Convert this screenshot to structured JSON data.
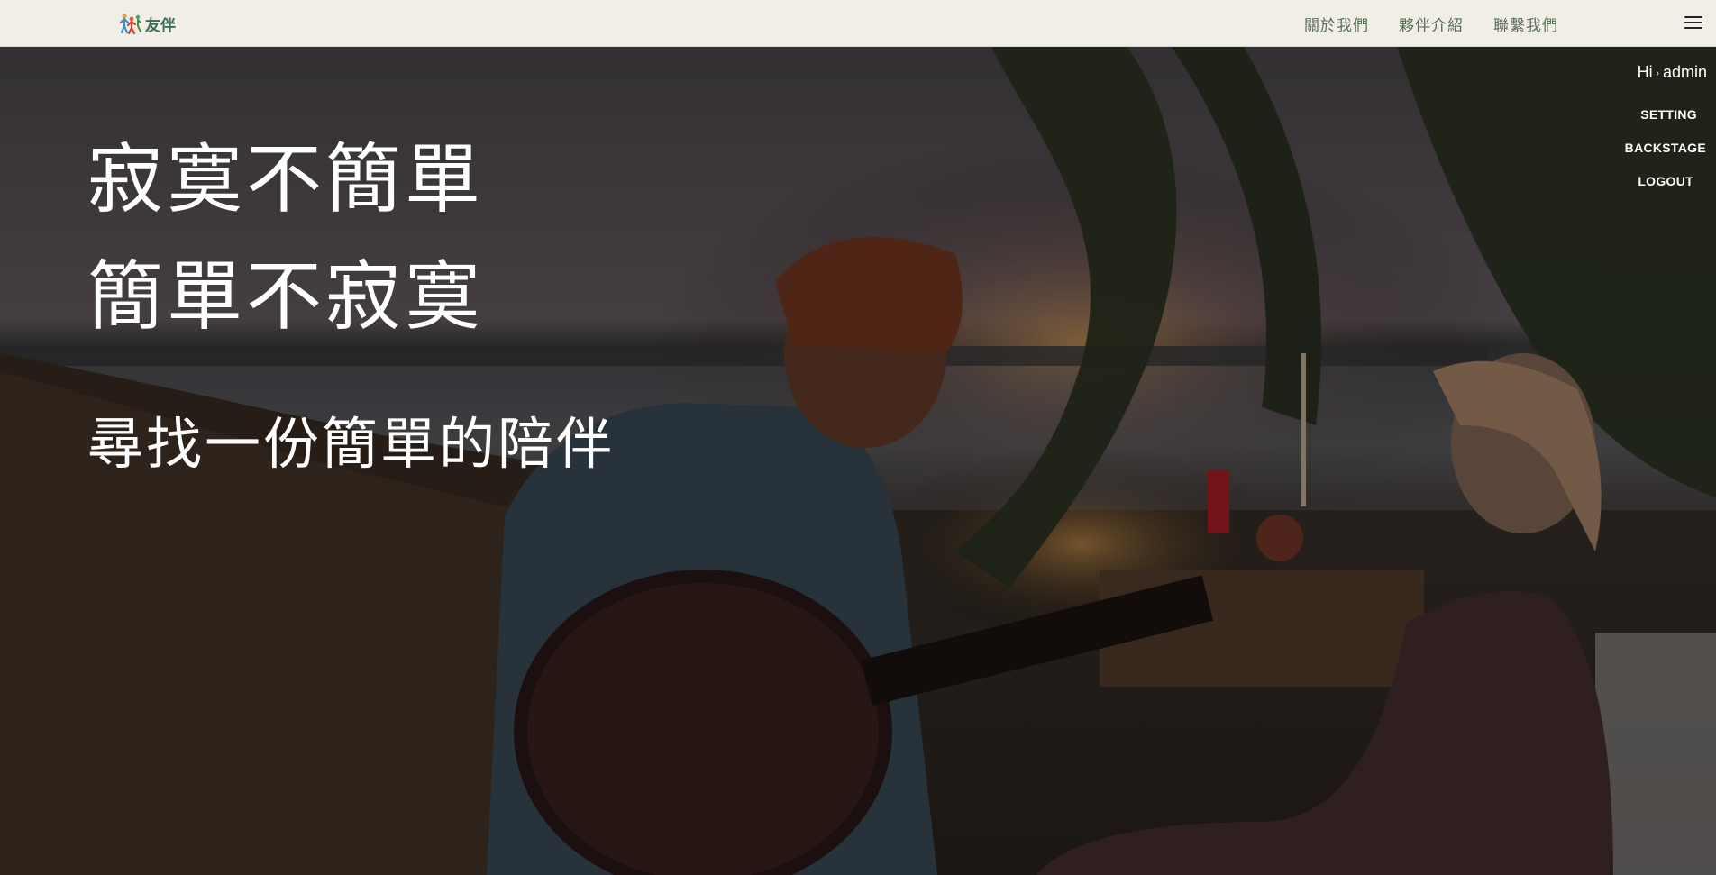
{
  "brand": {
    "name": "友伴"
  },
  "nav": {
    "links": [
      {
        "label": "關於我們"
      },
      {
        "label": "夥伴介紹"
      },
      {
        "label": "聯繫我們"
      }
    ]
  },
  "hero": {
    "line1": "寂寞不簡單",
    "line2": "簡單不寂寞",
    "tagline": "尋找一份簡單的陪伴"
  },
  "user_menu": {
    "greeting_prefix": "Hi",
    "greeting_sep": "›",
    "username": "admin",
    "items": [
      {
        "label": "SETTING"
      },
      {
        "label": "BACKSTAGE"
      },
      {
        "label": "LOGOUT"
      }
    ]
  },
  "colors": {
    "navbar_bg": "#f0eee6",
    "nav_link": "#5b6e55",
    "brand_text": "#3c6b4e"
  }
}
